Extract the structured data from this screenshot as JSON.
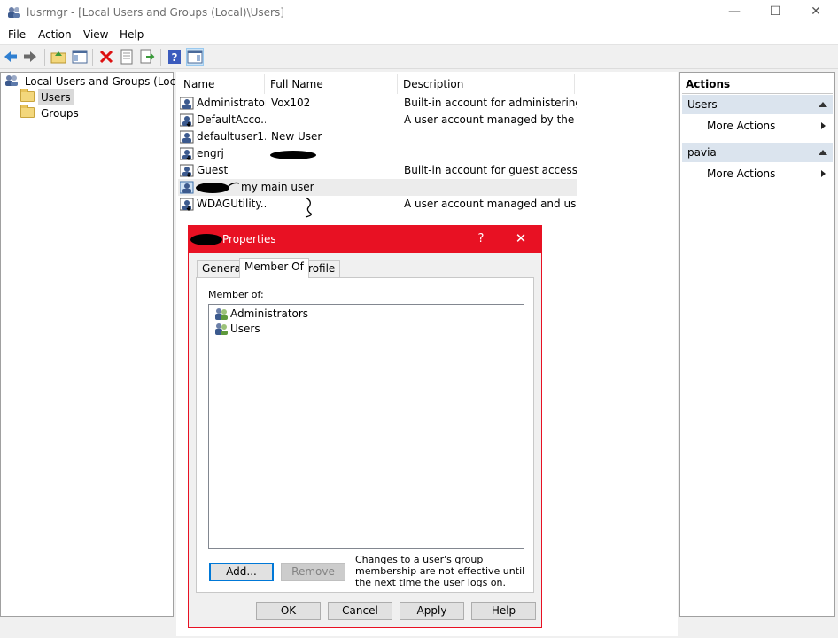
{
  "window": {
    "title": "lusrmgr - [Local Users and Groups (Local)\\Users]",
    "minimize": "—",
    "maximize": "☐",
    "close": "✕"
  },
  "menu": [
    "File",
    "Action",
    "View",
    "Help"
  ],
  "toolbar": {
    "icons": [
      "back-arrow-icon",
      "forward-arrow-icon",
      "up-folder-icon",
      "show-hide-tree-icon",
      "delete-icon",
      "properties-icon",
      "export-list-icon",
      "help-icon",
      "show-hide-action-pane-icon"
    ]
  },
  "tree": {
    "root": "Local Users and Groups (Local)",
    "items": [
      "Users",
      "Groups"
    ],
    "selected": "Users"
  },
  "list": {
    "columns": [
      "Name",
      "Full Name",
      "Description"
    ],
    "rows": [
      {
        "name": "Administrator",
        "full_name": "Vox102",
        "description": "Built-in account for administering..."
      },
      {
        "name": "DefaultAcco...",
        "full_name": "",
        "description": "A user account managed by the s..."
      },
      {
        "name": "defaultuser1...",
        "full_name": "New User",
        "description": ""
      },
      {
        "name": "engrj",
        "full_name": "",
        "description": ""
      },
      {
        "name": "Guest",
        "full_name": "",
        "description": "Built-in account for guest access t..."
      },
      {
        "name": "",
        "full_name": "",
        "description": "",
        "annotation": "my main user"
      },
      {
        "name": "WDAGUtility...",
        "full_name": "",
        "description": "A user account managed and use..."
      }
    ]
  },
  "actions": {
    "header": "Actions",
    "sections": [
      {
        "title": "Users",
        "items": [
          "More Actions"
        ]
      },
      {
        "title": "pavia",
        "items": [
          "More Actions"
        ]
      }
    ]
  },
  "dialog": {
    "title": "Properties",
    "help": "?",
    "close": "✕",
    "tabs": [
      "General",
      "Member Of",
      "Profile"
    ],
    "active_tab": "Member Of",
    "member_of_label": "Member of:",
    "members": [
      "Administrators",
      "Users"
    ],
    "add_button": "Add...",
    "remove_button": "Remove",
    "note": "Changes to a user's group membership are not effective until the next time the user logs on.",
    "ok": "OK",
    "cancel": "Cancel",
    "apply": "Apply",
    "help_button": "Help"
  },
  "colors": {
    "dialog_accent": "#e81123",
    "selection": "#d9d9d9",
    "action_section": "#dbe4ee",
    "default_button_border": "#0078d7"
  }
}
